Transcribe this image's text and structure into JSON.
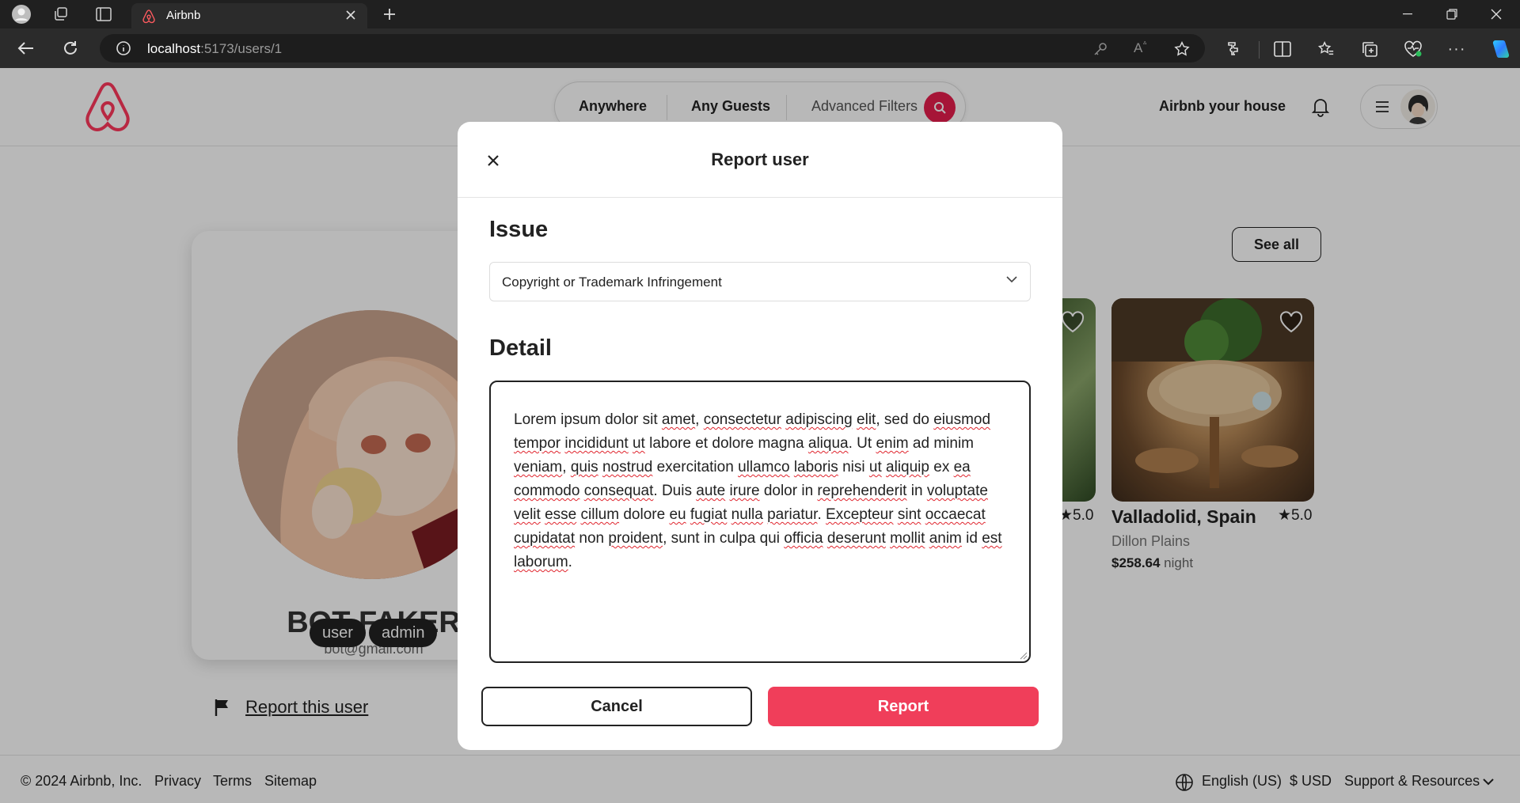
{
  "browser": {
    "tab_title": "Airbnb",
    "url_host": "localhost",
    "url_path": ":5173/users/1"
  },
  "header": {
    "search_segments": [
      "Anywhere",
      "Any Guests",
      "Advanced Filters"
    ],
    "host_link": "Airbnb your house"
  },
  "profile": {
    "name": "BOT FAKER",
    "email": "bot@gmail.com",
    "roles": [
      "user",
      "admin"
    ],
    "report_link": "Report this user"
  },
  "listings": {
    "see_all": "See all",
    "left_rating": "★5.0",
    "title": "Valladolid, Spain",
    "rating": "★5.0",
    "host": "Dillon Plains",
    "price": "$258.64",
    "price_unit": " night"
  },
  "footer": {
    "copyright": "© 2024 Airbnb, Inc.",
    "links": [
      "Privacy",
      "Terms",
      "Sitemap"
    ],
    "language": "English (US)",
    "currency": "$ USD",
    "support": "Support & Resources"
  },
  "modal": {
    "title": "Report user",
    "issue_heading": "Issue",
    "issue_value": "Copyright or Trademark Infringement",
    "detail_heading": "Detail",
    "detail_text": "Lorem ipsum dolor sit amet, consectetur adipiscing elit, sed do eiusmod tempor incididunt ut labore et dolore magna aliqua. Ut enim ad minim veniam, quis nostrud exercitation ullamco laboris nisi ut aliquip ex ea commodo consequat. Duis aute irure dolor in reprehenderit in voluptate velit esse cillum dolore eu fugiat nulla pariatur. Excepteur sint occaecat cupidatat non proident, sunt in culpa qui officia deserunt mollit anim id est laborum.",
    "cancel_label": "Cancel",
    "report_label": "Report"
  },
  "colors": {
    "brand": "#e61e4d",
    "report_button": "#f03e5a"
  }
}
